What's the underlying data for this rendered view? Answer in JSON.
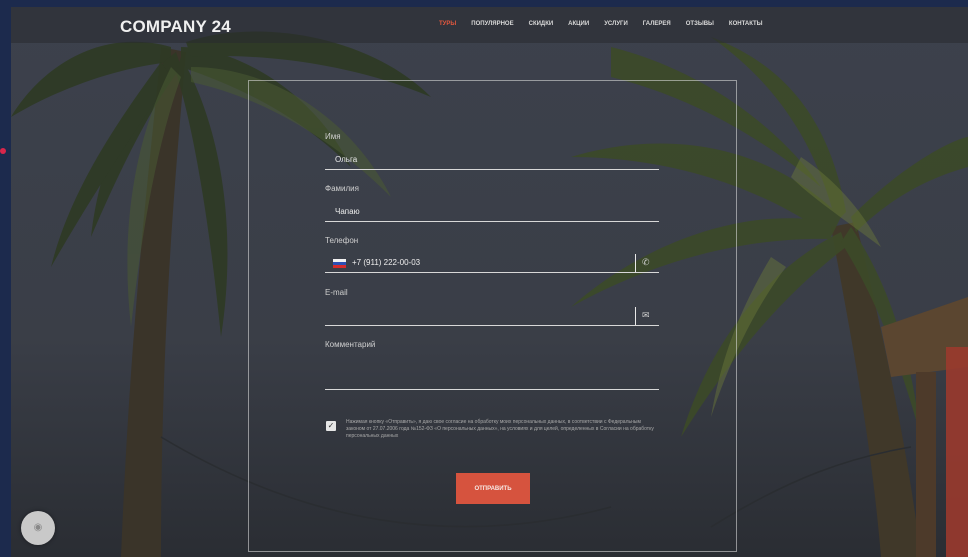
{
  "brand": {
    "logo_text": "COMPANY 24"
  },
  "nav": {
    "items": [
      {
        "label": "ТУРЫ",
        "active": true
      },
      {
        "label": "ПОПУЛЯРНОЕ",
        "active": false
      },
      {
        "label": "СКИДКИ",
        "active": false
      },
      {
        "label": "АКЦИИ",
        "active": false
      },
      {
        "label": "УСЛУГИ",
        "active": false
      },
      {
        "label": "ГАЛЕРЕЯ",
        "active": false
      },
      {
        "label": "ОТЗЫВЫ",
        "active": false
      },
      {
        "label": "КОНТАКТЫ",
        "active": false
      }
    ]
  },
  "form": {
    "name_label": "Имя",
    "name_value": "Ольга",
    "surname_label": "Фамилия",
    "surname_value": "Чапаю",
    "phone_label": "Телефон",
    "phone_value": "+7 (911) 222-00-03",
    "email_label": "E-mail",
    "email_value": "",
    "comment_label": "Комментарий",
    "comment_value": "",
    "consent_checked": true,
    "consent_text": "Нажимая кнопку «Отправить», я даю свое согласие на обработку моих персональных данных, в соответствии с Федеральным законом от 27.07.2006 года №152-ФЗ «О персональных данных», на условиях и для целей, определенных в Согласии на обработку персональных данных",
    "submit_label": "ОТПРАВИТЬ"
  },
  "colors": {
    "accent": "#d6533e",
    "decor": "#d8264b",
    "page_bg": "#1c2a4d"
  },
  "icons": {
    "phone": "phone-icon",
    "email": "envelope-icon",
    "check": "checkmark-icon",
    "fab": "chat-icon"
  }
}
